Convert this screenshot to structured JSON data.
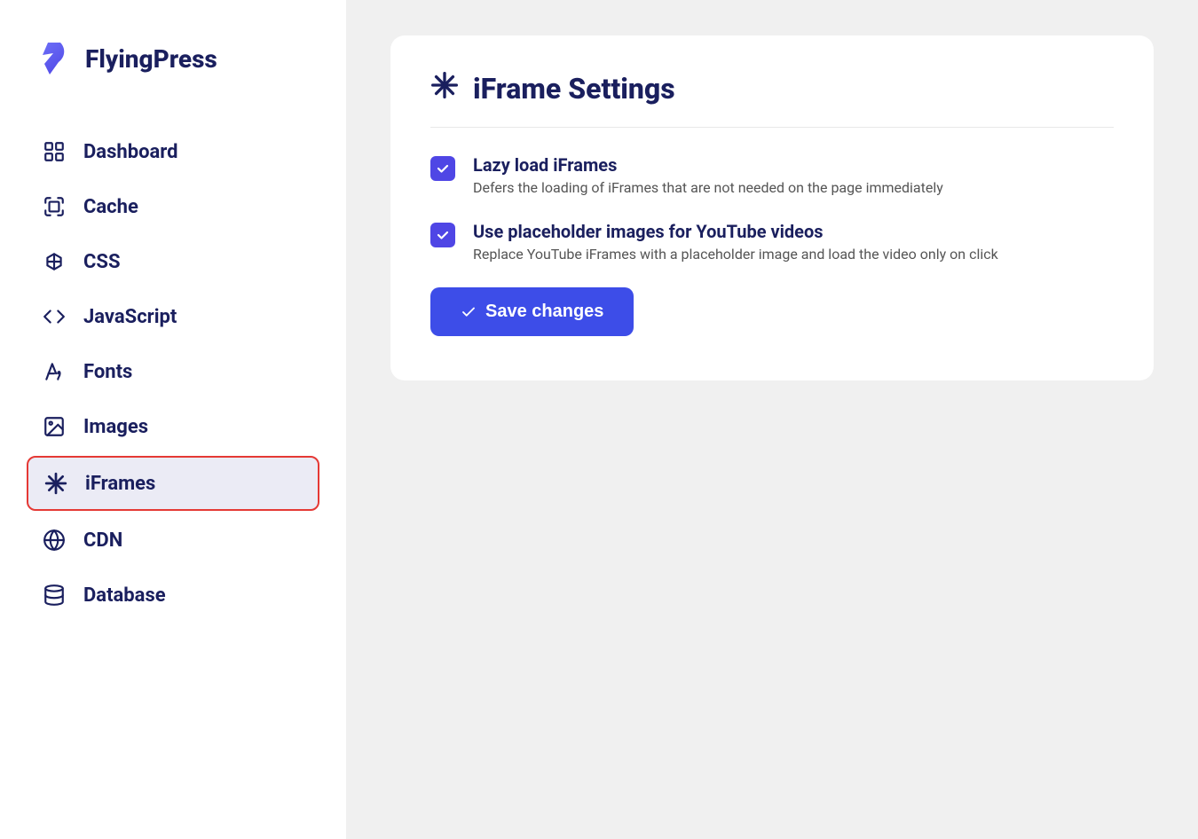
{
  "logo": {
    "text": "FlyingPress"
  },
  "nav": {
    "items": [
      {
        "id": "dashboard",
        "label": "Dashboard",
        "icon": "dashboard-icon",
        "active": false
      },
      {
        "id": "cache",
        "label": "Cache",
        "icon": "cache-icon",
        "active": false
      },
      {
        "id": "css",
        "label": "CSS",
        "icon": "css-icon",
        "active": false
      },
      {
        "id": "javascript",
        "label": "JavaScript",
        "icon": "javascript-icon",
        "active": false
      },
      {
        "id": "fonts",
        "label": "Fonts",
        "icon": "fonts-icon",
        "active": false
      },
      {
        "id": "images",
        "label": "Images",
        "icon": "images-icon",
        "active": false
      },
      {
        "id": "iframes",
        "label": "iFrames",
        "icon": "iframes-icon",
        "active": true
      },
      {
        "id": "cdn",
        "label": "CDN",
        "icon": "cdn-icon",
        "active": false
      },
      {
        "id": "database",
        "label": "Database",
        "icon": "database-icon",
        "active": false
      }
    ]
  },
  "page": {
    "title": "iFrame Settings",
    "options": [
      {
        "id": "lazy-load",
        "title": "Lazy load iFrames",
        "description": "Defers the loading of iFrames that are not needed on the page immediately",
        "checked": true
      },
      {
        "id": "placeholder-images",
        "title": "Use placeholder images for YouTube videos",
        "description": "Replace YouTube iFrames with a placeholder image and load the video only on click",
        "checked": true
      }
    ],
    "save_button_label": "Save changes"
  }
}
